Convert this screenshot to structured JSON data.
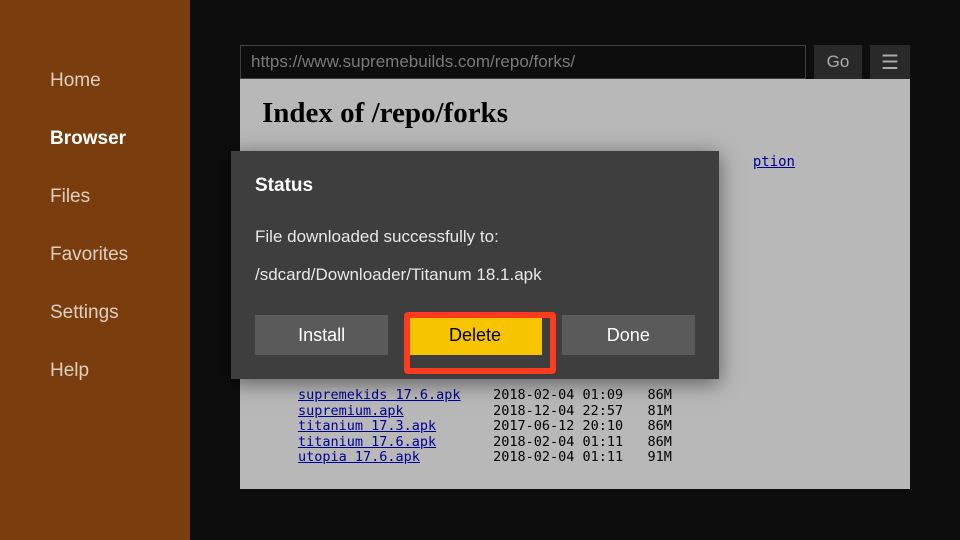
{
  "sidebar": {
    "items": [
      {
        "label": "Home"
      },
      {
        "label": "Browser"
      },
      {
        "label": "Files"
      },
      {
        "label": "Favorites"
      },
      {
        "label": "Settings"
      },
      {
        "label": "Help"
      }
    ],
    "active_index": 1
  },
  "url_bar": {
    "value": "https://www.supremebuilds.com/repo/forks/",
    "go_label": "Go"
  },
  "page": {
    "heading": "Index of /repo/forks",
    "description_link": "ption",
    "listing": [
      {
        "name": "supremekids 17.6.apk",
        "date": "2018-02-04 01:09",
        "size": "86M"
      },
      {
        "name": "supremium.apk",
        "date": "2018-12-04 22:57",
        "size": "81M"
      },
      {
        "name": "titanium 17.3.apk",
        "date": "2017-06-12 20:10",
        "size": "86M"
      },
      {
        "name": "titanium 17.6.apk",
        "date": "2018-02-04 01:11",
        "size": "86M"
      },
      {
        "name": "utopia 17.6.apk",
        "date": "2018-02-04 01:11",
        "size": "91M"
      }
    ]
  },
  "dialog": {
    "title": "Status",
    "message": "File downloaded successfully to:",
    "path": "/sdcard/Downloader/Titanum 18.1.apk",
    "buttons": {
      "install": "Install",
      "delete": "Delete",
      "done": "Done"
    }
  }
}
